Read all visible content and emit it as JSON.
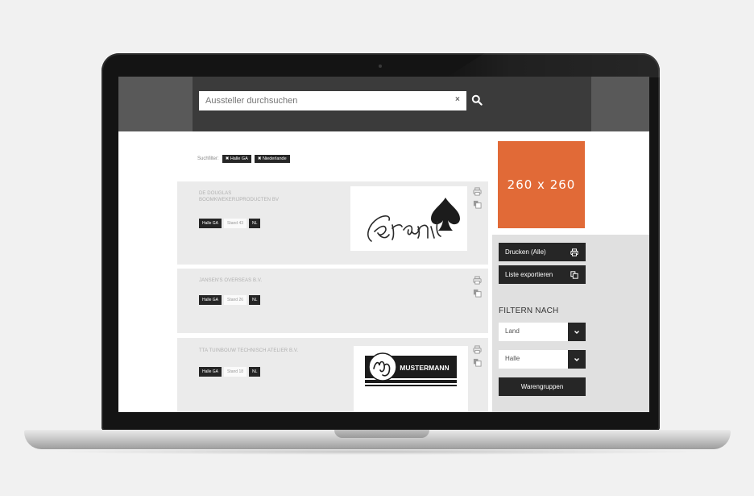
{
  "search": {
    "placeholder": "Aussteller durchsuchen",
    "clear_symbol": "×"
  },
  "active_filters": {
    "label": "Suchfilter:",
    "chips": [
      {
        "label": "Halle GA"
      },
      {
        "label": "Niederlande"
      }
    ],
    "chip_remove_symbol": "✖"
  },
  "exhibitors": [
    {
      "name_lines": [
        "DE DOUGLAS",
        "BOOMKWEKERIJPRODUCTEN BV"
      ],
      "hall": "Halle GA",
      "stand": "Stand 43",
      "country": "NL",
      "has_logo": true,
      "logo": "Granate"
    },
    {
      "name_lines": [
        "JANSEN'S OVERSEAS B.V."
      ],
      "hall": "Halle GA",
      "stand": "Stand 26",
      "country": "NL",
      "has_logo": false
    },
    {
      "name_lines": [
        "TTA TUINBOUW TECHNISCH ATELIER B.V."
      ],
      "hall": "Halle GA",
      "stand": "Stand 18",
      "country": "NL",
      "has_logo": true,
      "logo": "MUSTERMANN"
    }
  ],
  "ad": {
    "label": "260 x 260",
    "color": "#e16a37"
  },
  "sidebar": {
    "print_all_label": "Drucken (Alle)",
    "export_label": "Liste exportieren",
    "filter_heading": "FILTERN NACH",
    "dropdowns": [
      {
        "label": "Land"
      },
      {
        "label": "Halle"
      }
    ],
    "groups_label": "Warengruppen"
  },
  "icons": [
    "search-icon",
    "print-icon",
    "copy-icon",
    "export-icon",
    "chevron-down-icon"
  ]
}
